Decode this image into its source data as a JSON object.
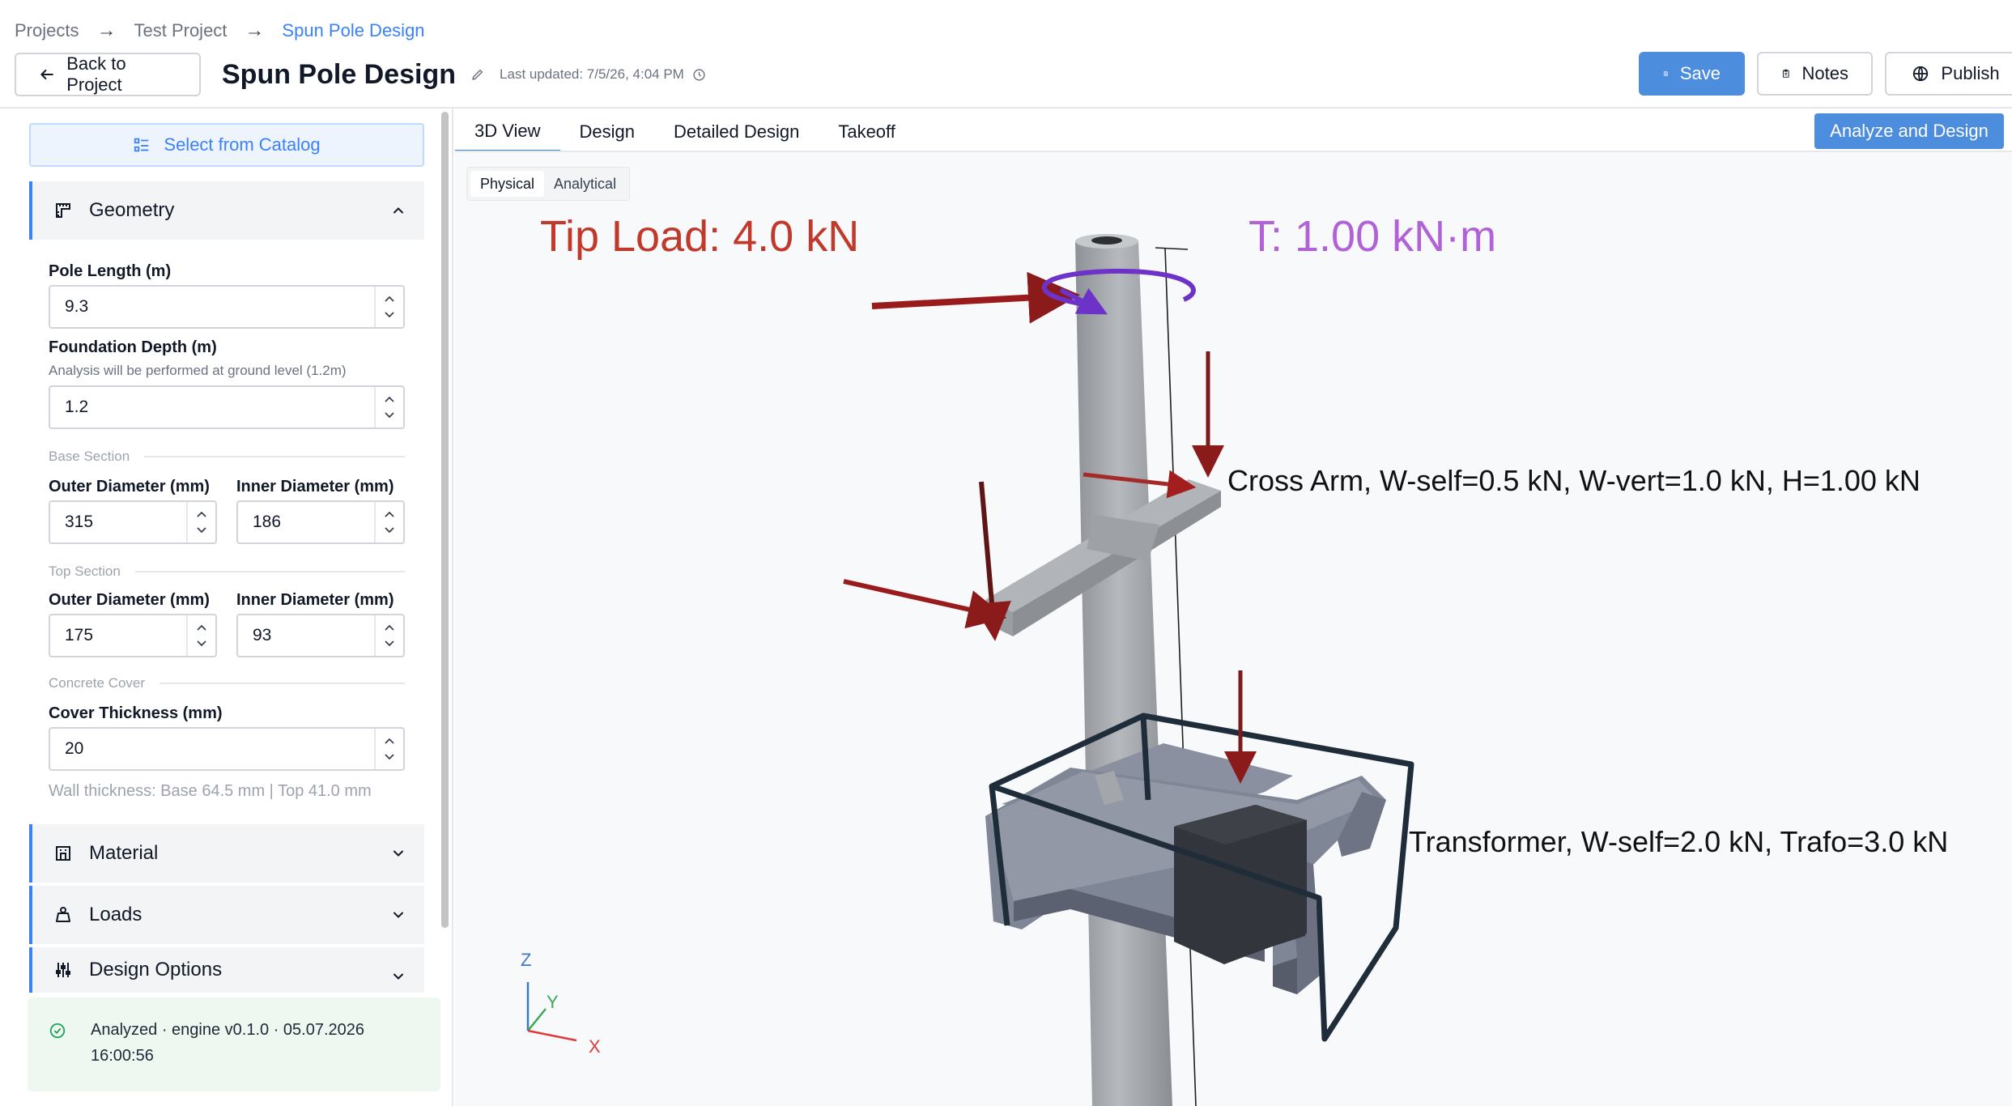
{
  "breadcrumb": {
    "items": [
      "Projects",
      "Test Project",
      "Spun Pole Design"
    ],
    "separator": "→"
  },
  "header": {
    "back_label": "Back to Project",
    "title": "Spun Pole Design",
    "last_updated": "Last updated: 7/5/26, 4:04 PM",
    "save_label": "Save",
    "notes_label": "Notes",
    "publish_label": "Publish"
  },
  "sidebar": {
    "catalog_label": "Select from Catalog",
    "geometry_title": "Geometry",
    "pole_length": {
      "label": "Pole Length (m)",
      "value": "9.3"
    },
    "foundation_depth": {
      "label": "Foundation Depth (m)",
      "hint": "Analysis will be performed at ground level (1.2m)",
      "value": "1.2"
    },
    "base_section": {
      "title": "Base Section",
      "outer": {
        "label": "Outer Diameter (mm)",
        "value": "315"
      },
      "inner": {
        "label": "Inner Diameter (mm)",
        "value": "186"
      }
    },
    "top_section": {
      "title": "Top Section",
      "outer": {
        "label": "Outer Diameter (mm)",
        "value": "175"
      },
      "inner": {
        "label": "Inner Diameter (mm)",
        "value": "93"
      }
    },
    "concrete_cover": {
      "title": "Concrete Cover",
      "thickness": {
        "label": "Cover Thickness (mm)",
        "value": "20"
      }
    },
    "wall_thickness": "Wall thickness: Base 64.5 mm | Top 41.0 mm",
    "material_title": "Material",
    "loads_title": "Loads",
    "design_options_title": "Design Options",
    "status": "Analyzed · engine v0.1.0 · 05.07.2026 16:00:56"
  },
  "tabs": [
    "3D View",
    "Design",
    "Detailed Design",
    "Takeoff"
  ],
  "analyze_label": "Analyze and Design",
  "view_modes": [
    "Physical",
    "Analytical"
  ],
  "scene": {
    "tip_load": "Tip Load: 4.0 kN",
    "torque": "T: 1.00 kN·m",
    "cross_arm": "Cross Arm, W-self=0.5 kN, W-vert=1.0 kN, H=1.00 kN",
    "transformer": "Transformer, W-self=2.0 kN, Trafo=3.0 kN",
    "axis_x": "X",
    "axis_y": "Y",
    "axis_z": "Z"
  },
  "colors": {
    "accent": "#4c8dde",
    "link": "#3b82f6",
    "tip_load": "#c0392b",
    "torque": "#b062d6",
    "arrow": "#8b1a1a",
    "status_ok": "#22a35a"
  }
}
